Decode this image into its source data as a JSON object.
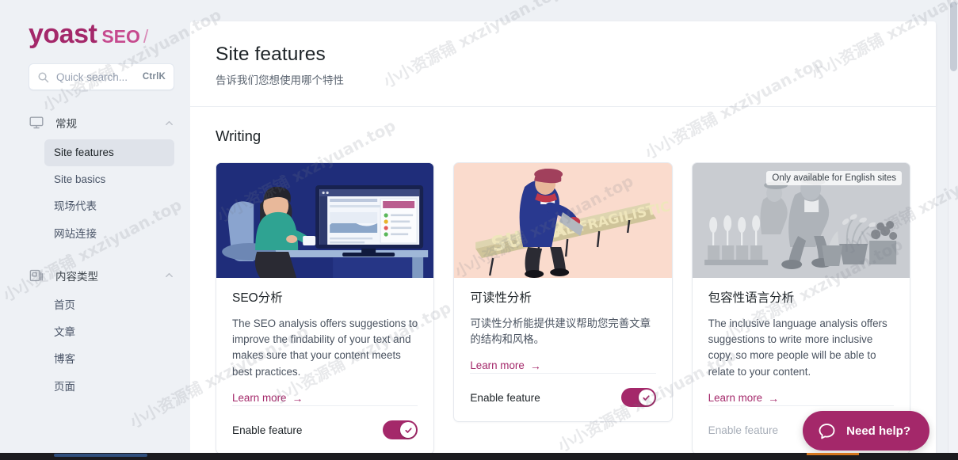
{
  "brand": {
    "name": "yoast",
    "product": "SEO",
    "slash": "/"
  },
  "search": {
    "placeholder": "Quick search...",
    "shortcut": "CtrlK",
    "icon": "search-icon"
  },
  "sidebar": {
    "groups": [
      {
        "label": "常规",
        "icon": "monitor-icon",
        "expanded": true,
        "chevron": "chevron-up-icon",
        "items": [
          {
            "label": "Site features",
            "active": true
          },
          {
            "label": "Site basics",
            "active": false
          },
          {
            "label": "现场代表",
            "active": false
          },
          {
            "label": "网站连接",
            "active": false
          }
        ]
      },
      {
        "label": "内容类型",
        "icon": "document-icon",
        "expanded": true,
        "chevron": "chevron-up-icon",
        "items": [
          {
            "label": "首页",
            "active": false
          },
          {
            "label": "文章",
            "active": false
          },
          {
            "label": "博客",
            "active": false
          },
          {
            "label": "页面",
            "active": false
          }
        ]
      }
    ]
  },
  "header": {
    "title": "Site features",
    "subtitle": "告诉我们您想使用哪个特性"
  },
  "section": {
    "title": "Writing"
  },
  "cards": [
    {
      "id": "seo-analysis",
      "title": "SEO分析",
      "description": "The SEO analysis offers suggestions to improve the findability of your text and makes sure that your content meets best practices.",
      "learn_more": "Learn more",
      "learn_more_arrow": "→",
      "enable_label": "Enable feature",
      "enabled": true,
      "disabled": false,
      "badge": null,
      "image_alt": "woman-at-desk-illustration",
      "image_bg": "#1f2d7a"
    },
    {
      "id": "readability-analysis",
      "title": "可读性分析",
      "description": "可读性分析能提供建议帮助您完善文章的结构和风格。",
      "learn_more": "Learn more",
      "learn_more_arrow": "→",
      "enable_label": "Enable feature",
      "enabled": true,
      "disabled": false,
      "badge": null,
      "image_alt": "woman-sawing-long-word-illustration",
      "image_bg": "#fadbcd"
    },
    {
      "id": "inclusive-language-analysis",
      "title": "包容性语言分析",
      "description": "The inclusive language analysis offers suggestions to write more inclusive copy, so more people will be able to relate to your content.",
      "learn_more": "Learn more",
      "learn_more_arrow": "→",
      "enable_label": "Enable feature",
      "enabled": false,
      "disabled": true,
      "badge": "Only available for English sites",
      "image_alt": "gardening-people-greyscale-illustration",
      "image_bg": "#c9ccd1"
    }
  ],
  "help_widget": {
    "label": "Need help?",
    "icon": "chat-bubble-icon"
  },
  "colors": {
    "brand_magenta": "#a4286a",
    "brand_pink": "#c64a8e",
    "sidebar_bg": "#eef1f5",
    "panel_bg": "#ffffff",
    "active_nav_bg": "#dfe3ea",
    "text_primary": "#1d2327",
    "text_secondary": "#4a5360"
  },
  "watermarks": [
    "小小资源铺 xxziyuan.top",
    "小小资源铺 xxziyuan.top",
    "小小资源铺 xxziyuan.top",
    "小小资源铺 xxziyuan.top",
    "小小资源铺 xxziyuan.top",
    "小小资源铺 xxziyuan.top",
    "小小资源铺 xxziyuan.top",
    "小小资源铺 xxziyuan.top",
    "小小资源铺 xxziyuan.top",
    "小小资源铺 xxziyuan.top",
    "小小资源铺 xxziyuan.top",
    "小小资源铺 xxziyuan.top"
  ],
  "scrollbar": {
    "up_arrow": "▲",
    "down_arrow": "▼"
  }
}
